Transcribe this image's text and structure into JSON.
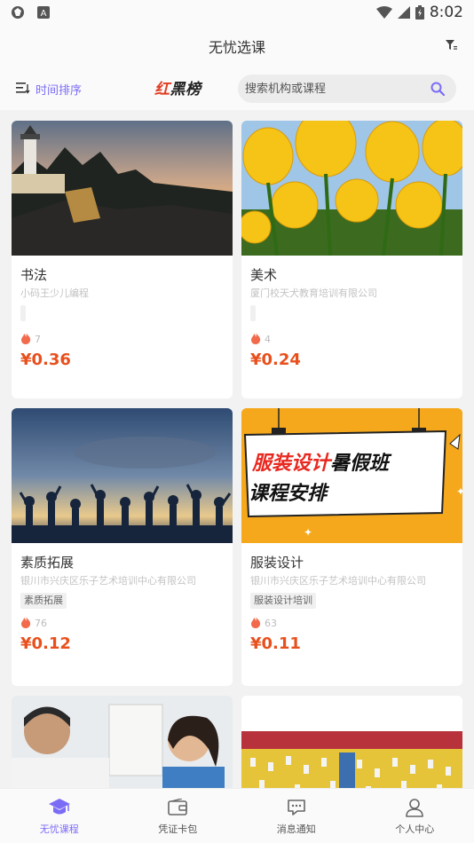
{
  "status_bar": {
    "time": "8:02",
    "left_icons": [
      "app-icon",
      "a-icon"
    ],
    "right_icons": [
      "wifi-icon",
      "signal-icon",
      "battery-icon"
    ]
  },
  "header": {
    "title": "无忧选课",
    "filter_icon": "filter-icon"
  },
  "toolbar": {
    "sort_label": "时间排序",
    "brand_part1": "红",
    "brand_part2": "黑榜",
    "search_placeholder": "搜索机构或课程"
  },
  "courses": [
    {
      "title": "书法",
      "org": "小码王少儿编程",
      "tag": "",
      "heat": "7",
      "price": "¥0.36"
    },
    {
      "title": "美术",
      "org": "厦门校天犬教育培训有限公司",
      "tag": "",
      "heat": "4",
      "price": "¥0.24"
    },
    {
      "title": "素质拓展",
      "org": "银川市兴庆区乐子艺术培训中心有限公司",
      "tag": "素质拓展",
      "heat": "76",
      "price": "¥0.12"
    },
    {
      "title": "服装设计",
      "org": "银川市兴庆区乐子艺术培训中心有限公司",
      "tag": "服装设计培训",
      "heat": "63",
      "price": "¥0.11",
      "banner_line1_a": "服装设计",
      "banner_line1_b": "暑假班",
      "banner_line2": "课程安排"
    }
  ],
  "bottom_nav": [
    {
      "label": "无忧课程",
      "icon": "graduation-cap-icon",
      "active": true
    },
    {
      "label": "凭证卡包",
      "icon": "wallet-icon",
      "active": false
    },
    {
      "label": "消息通知",
      "icon": "message-icon",
      "active": false
    },
    {
      "label": "个人中心",
      "icon": "user-icon",
      "active": false
    }
  ],
  "colors": {
    "accent": "#7b6cf6",
    "price": "#e8501d",
    "heat": "#f26a4b",
    "brand_red": "#e23b1f"
  }
}
